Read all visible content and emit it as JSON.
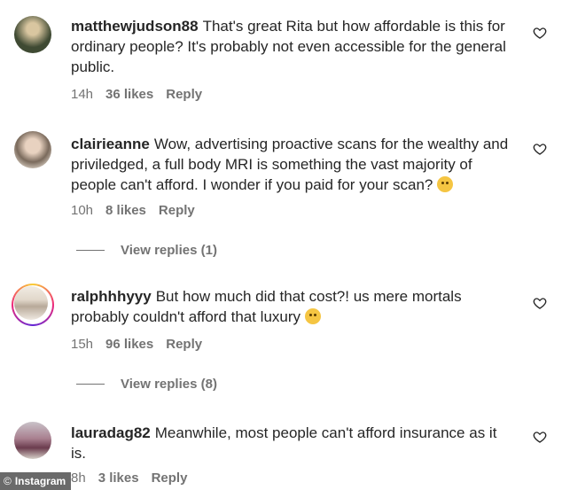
{
  "comments": [
    {
      "username": "matthewjudson88",
      "text": "That's great Rita but how affordable is this for ordinary people? It's probably not even accessible for the general public.",
      "time": "14h",
      "likes": "36 likes",
      "reply": "Reply",
      "avatar_color": "#4a5a3c"
    },
    {
      "username": "clairieanne",
      "text": "Wow, advertising proactive scans for the wealthy and priviledged, a full body MRI is something the vast majority of people can't afford. I wonder if you paid for your scan?",
      "time": "10h",
      "likes": "8 likes",
      "reply": "Reply",
      "view_replies": "View replies (1)",
      "avatar_color": "#b9a89a"
    },
    {
      "username": "ralphhhyyy",
      "text": "But how much did that cost?! us mere mortals probably couldn't afford that luxury",
      "time": "15h",
      "likes": "96 likes",
      "reply": "Reply",
      "view_replies": "View replies (8)",
      "avatar_color": "#d8cfc2"
    },
    {
      "username": "lauradag82",
      "text": "Meanwhile, most people can't afford insurance as it is.",
      "time": "8h",
      "likes": "3 likes",
      "reply": "Reply",
      "avatar_color": "#8a5a6a"
    }
  ],
  "watermark": {
    "symbol": "©",
    "label": "Instagram"
  },
  "icons": {
    "like": "heart-icon",
    "emoji": "monocle-face-emoji"
  }
}
